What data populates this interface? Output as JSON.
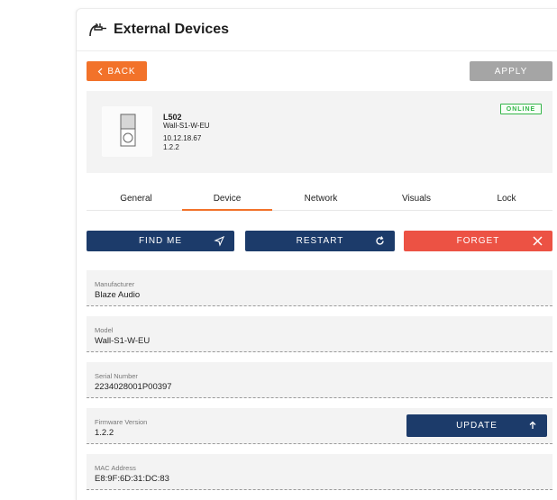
{
  "page": {
    "title": "External Devices"
  },
  "toolbar": {
    "back_label": "BACK",
    "apply_label": "APPLY"
  },
  "device": {
    "name": "L502",
    "model": "Wall-S1-W-EU",
    "ip": "10.12.18.67",
    "version": "1.2.2",
    "status": "ONLINE"
  },
  "tabs": [
    "General",
    "Device",
    "Network",
    "Visuals",
    "Lock"
  ],
  "active_tab": "Device",
  "actions": {
    "find_me": "FIND ME",
    "restart": "RESTART",
    "forget": "FORGET"
  },
  "fields": [
    {
      "label": "Manufacturer",
      "value": "Blaze Audio"
    },
    {
      "label": "Model",
      "value": "Wall-S1-W-EU"
    },
    {
      "label": "Serial Number",
      "value": "2234028001P00397"
    },
    {
      "label": "Firmware Version",
      "value": "1.2.2"
    },
    {
      "label": "MAC Address",
      "value": "E8:9F:6D:31:DC:83"
    }
  ],
  "firmware": {
    "update_label": "UPDATE"
  },
  "colors": {
    "accent": "#f2722a",
    "navy": "#1c3b6a",
    "danger": "#ec5244",
    "online": "#35b54a",
    "disabled": "#a5a5a5"
  },
  "icons": {
    "header": "external-device-icon",
    "back": "chevron-left-icon",
    "find_me": "send-icon",
    "restart": "refresh-icon",
    "forget": "close-icon",
    "update": "arrow-up-icon"
  }
}
